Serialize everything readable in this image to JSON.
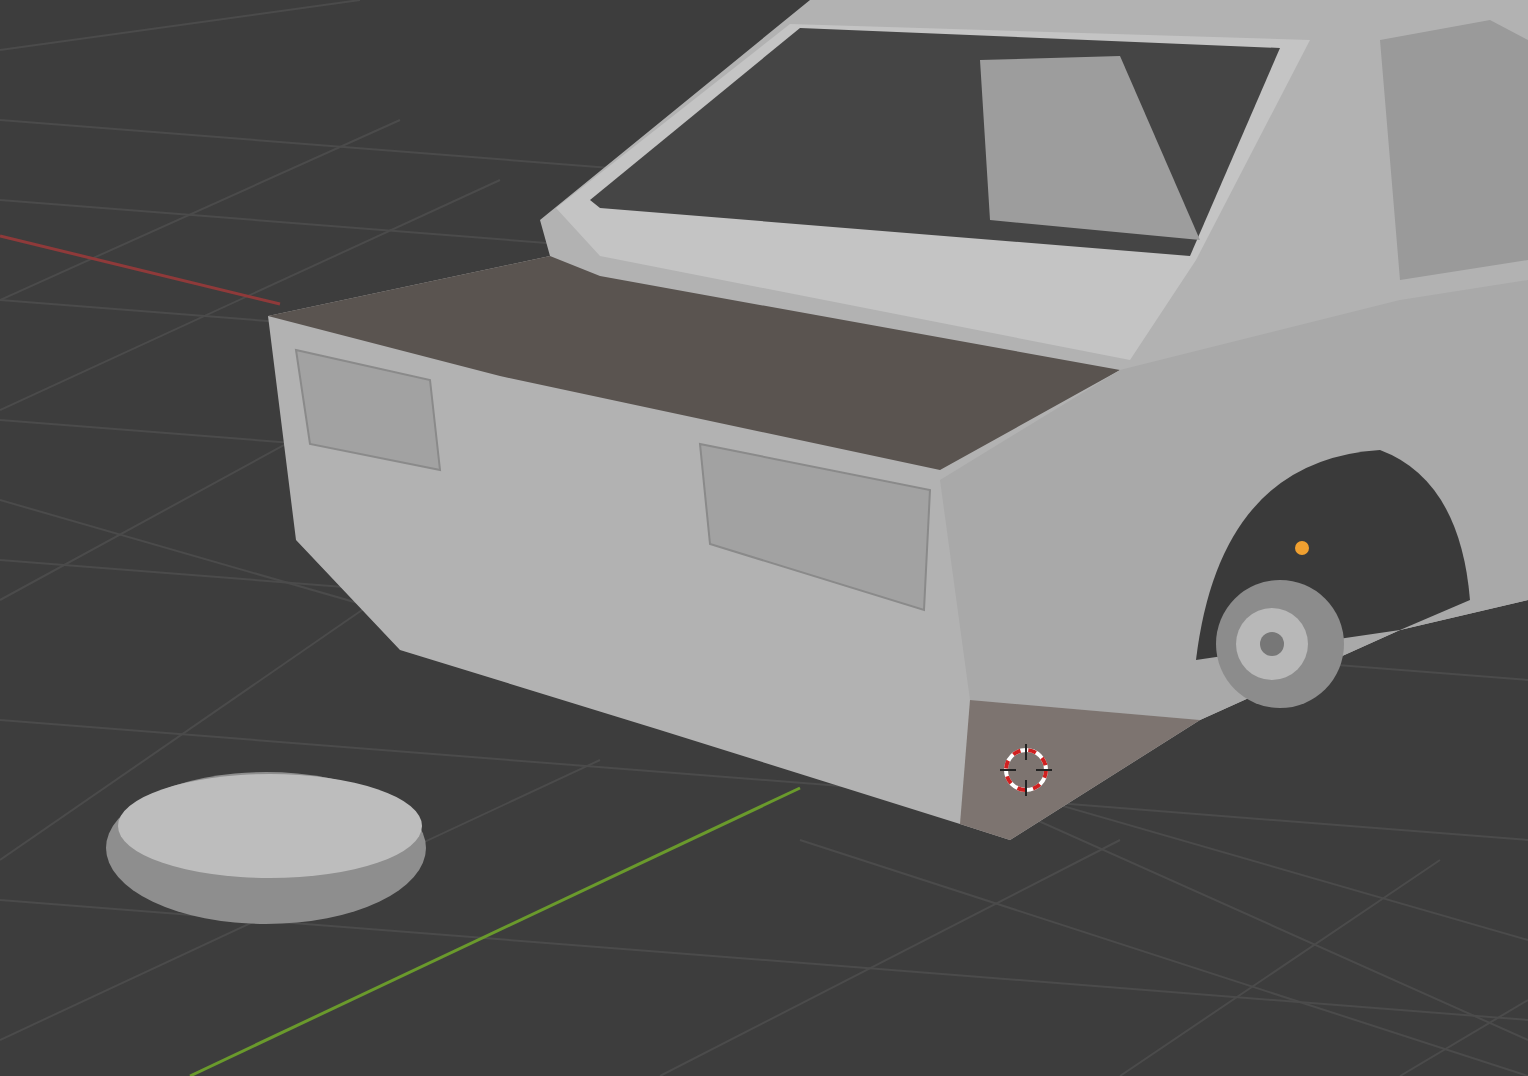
{
  "viewport": {
    "axes": [
      {
        "kind": "x",
        "color": "#8f3a3a"
      },
      {
        "kind": "y",
        "color": "#6a9a2c"
      }
    ],
    "objects": [
      {
        "kind": "car",
        "selected": true
      },
      {
        "kind": "hubcap",
        "selected": false
      }
    ],
    "cursor": {
      "kind": "crosshair"
    }
  }
}
